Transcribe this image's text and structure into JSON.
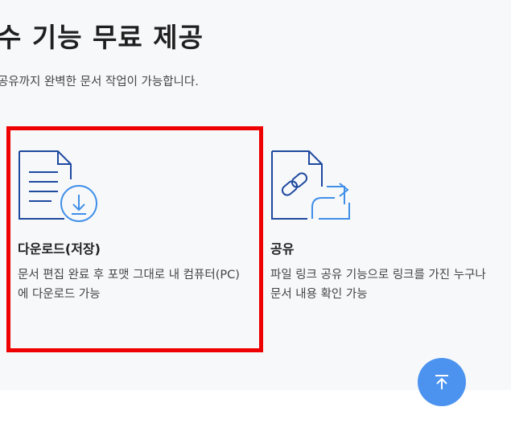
{
  "section": {
    "headline": "수 기능 무료 제공",
    "subline": "공유까지 완벽한 문서 작업이 가능합니다."
  },
  "features": [
    {
      "title": "다운로드(저장)",
      "description": "문서 편집 완료 후 포맷 그대로 내 컴퓨터(PC)\n에 다운로드 가능",
      "icon": "document-download-icon",
      "highlighted": true
    },
    {
      "title": "공유",
      "description": "파일 링크 공유 기능으로 링크를 가진 누구나\n문서 내용 확인 가능",
      "icon": "document-link-share-icon",
      "highlighted": false
    }
  ],
  "colors": {
    "section_bg": "#f7f8fa",
    "icon_dark": "#1e4aa0",
    "icon_light": "#3f8fe8",
    "highlight_border": "#ee0000",
    "top_button": "#4b93ef"
  },
  "scroll_top_button": {
    "icon": "arrow-up-icon"
  }
}
